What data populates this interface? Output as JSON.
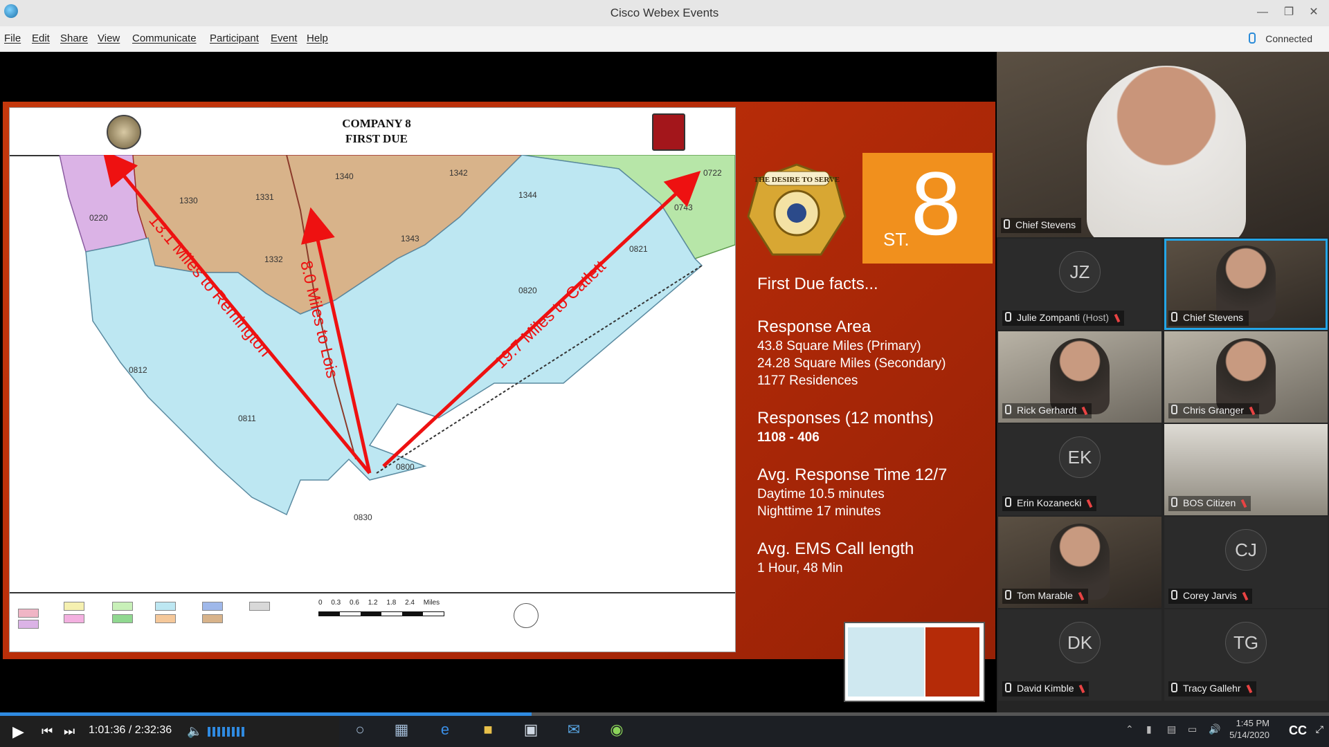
{
  "window": {
    "title": "Cisco Webex Events",
    "status": "Connected"
  },
  "menu": [
    "File",
    "Edit",
    "Share",
    "View",
    "Communicate",
    "Participant",
    "Event",
    "Help"
  ],
  "map": {
    "title_line1": "COMPANY 8",
    "title_line2": "FIRST DUE",
    "zones": [
      "0220",
      "1330",
      "1331",
      "1340",
      "1342",
      "1344",
      "1343",
      "1332",
      "0722",
      "0743",
      "0821",
      "0820",
      "0812",
      "0811",
      "0800",
      "0830"
    ],
    "arrow_labels": [
      "13.1 Miles to Remington",
      "8.0 Miles to Lois",
      "19.7 Miles to Catlett"
    ],
    "scale_ticks": [
      "0",
      "0.3",
      "0.6",
      "1.2",
      "1.8",
      "2.4"
    ],
    "scale_unit": "Miles"
  },
  "slide": {
    "station_prefix": "ST.",
    "station_number": "8",
    "logo_text": "THE DESIRE TO SERVE",
    "facts_title": "First Due facts...",
    "sections": [
      {
        "heading": "Response Area",
        "lines": [
          "43.8   Square Miles (Primary)",
          "24.28 Square Miles  (Secondary)",
          "1177 Residences"
        ]
      },
      {
        "heading": "Responses (12 months)",
        "lines": [
          "1108 - 406"
        ]
      },
      {
        "heading": "Avg. Response Time 12/7",
        "lines": [
          "Daytime 10.5 minutes",
          "Nighttime 17 minutes"
        ]
      },
      {
        "heading": "Avg. EMS Call length",
        "lines": [
          "1 Hour, 48 Min"
        ]
      }
    ]
  },
  "participants": [
    {
      "name": "Chief Stevens",
      "host": "",
      "initials": "",
      "kind": "video"
    },
    {
      "name": "Julie Zompanti",
      "host": "(Host)",
      "initials": "JZ",
      "kind": "avatar"
    },
    {
      "name": "Chief Stevens",
      "host": "",
      "initials": "",
      "kind": "video"
    },
    {
      "name": "Rick Gerhardt",
      "host": "",
      "initials": "",
      "kind": "video"
    },
    {
      "name": "Chris Granger",
      "host": "",
      "initials": "",
      "kind": "video"
    },
    {
      "name": "Erin Kozanecki",
      "host": "",
      "initials": "EK",
      "kind": "avatar"
    },
    {
      "name": "BOS Citizen",
      "host": "",
      "initials": "",
      "kind": "video"
    },
    {
      "name": "Tom Marable",
      "host": "",
      "initials": "",
      "kind": "video"
    },
    {
      "name": "Corey Jarvis",
      "host": "",
      "initials": "CJ",
      "kind": "avatar"
    },
    {
      "name": "David Kimble",
      "host": "",
      "initials": "DK",
      "kind": "avatar"
    },
    {
      "name": "Tracy Gallehr",
      "host": "",
      "initials": "TG",
      "kind": "avatar"
    }
  ],
  "player": {
    "elapsed": "1:01:36",
    "total": "2:32:36",
    "progress": 0.4
  },
  "taskbar": {
    "time": "1:45 PM",
    "date": "5/14/2020",
    "cc": "CC"
  },
  "colors": {
    "accent": "#2f8ae0",
    "slide_red": "#b52b08",
    "station_orange": "#f1901d",
    "arrow_red": "#ee1111"
  }
}
